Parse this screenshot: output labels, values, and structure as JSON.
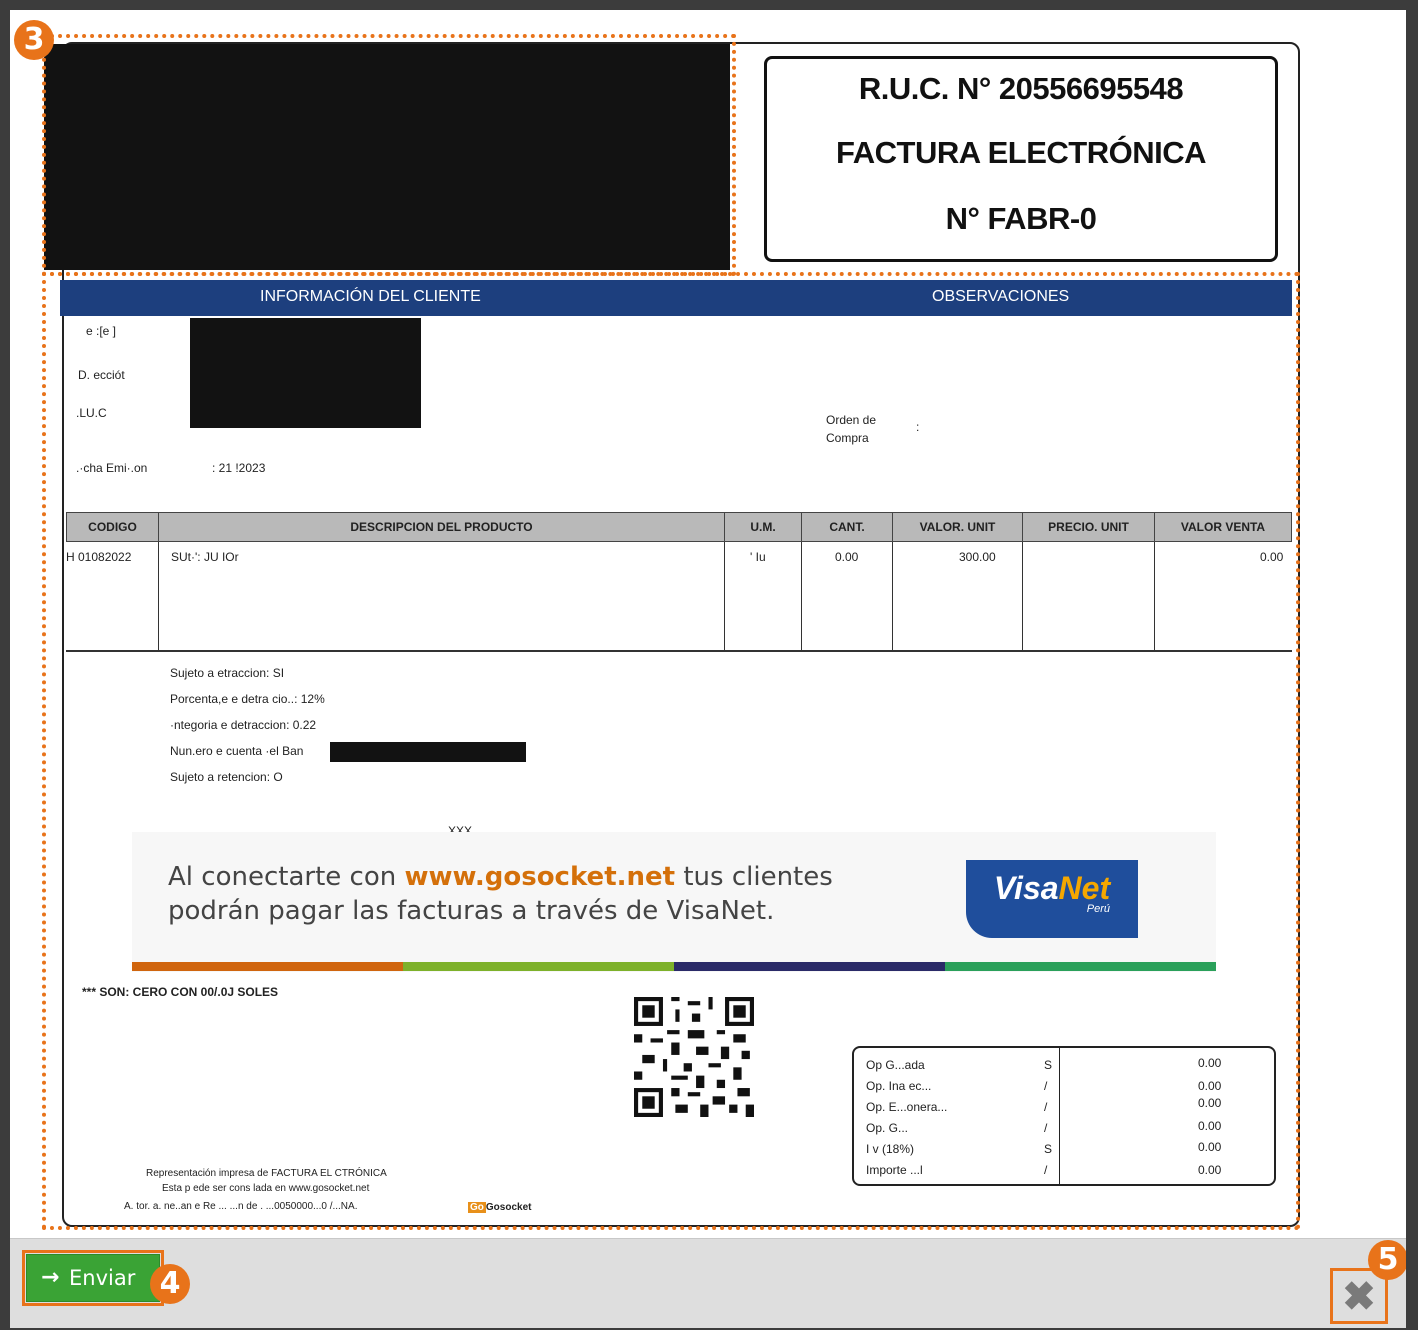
{
  "invoice": {
    "ruc_line": "R.U.C. N° 20556695548",
    "type_line": "FACTURA ELECTRÓNICA",
    "number_line": "N° FABR-0"
  },
  "sections": {
    "client_info": "INFORMACIÓN DEL CLIENTE",
    "observations": "OBSERVACIONES"
  },
  "client": {
    "name_label": "e  :[e ]",
    "address_label": "D. ecciót",
    "ruc_label": ".LU.C",
    "date_label": ".·cha Emi·.on",
    "date_value": ":   21    !2023",
    "order_label_1": "Orden de",
    "order_label_2": "Compra",
    "order_colon": ":"
  },
  "table": {
    "headers": [
      "CODIGO",
      "DESCRIPCION DEL PRODUCTO",
      "U.M.",
      "CANT.",
      "VALOR. UNIT",
      "PRECIO. UNIT",
      "VALOR VENTA"
    ],
    "row": {
      "code": "H 01082022",
      "description": "SUt·': JU  IOr",
      "unit": "' Iu",
      "qty": "0.00",
      "unit_value": "300.00",
      "unit_price": "",
      "sale_value": "0.00"
    }
  },
  "details": [
    "Sujeto a   etraccion: SI",
    "Porcenta,e   e detra  cio..: 12%",
    "  ·ntegoria   e detraccion: 0.22",
    "Nun.ero   e cuenta ·el Ban",
    "Sujeto a retencion:    O"
  ],
  "observation_text": "XXX",
  "banner": {
    "line1_pre": "Al conectarte con ",
    "line1_link": "www.gosocket.net",
    "line1_post": " tus clientes",
    "line2": "podrán pagar las facturas a través de VisaNet.",
    "logo_main": "Visa",
    "logo_accent": "Net",
    "logo_sub": "Perú",
    "stripe_colors": [
      "#d0650e",
      "#7db12a",
      "#2a2a68",
      "#2aa05a"
    ]
  },
  "amount_in_words": "*** SON: CERO CON 00/.0J SOLES",
  "totals": {
    "labels": [
      "Op  G...ada",
      "Op. Ina ec...",
      "Op. E...onera...",
      "Op. G...",
      "I  v (18%)",
      "Importe ...l"
    ],
    "currency": [
      "S",
      "/",
      "/",
      "/",
      "S",
      "/"
    ],
    "values": [
      "0.00",
      "0.00",
      "0.00",
      "0.00",
      "0.00",
      "0.00"
    ]
  },
  "footer_notes": {
    "line1": "Representación impresa de FACTURA EL  CTRÓNICA",
    "line2": "Esta p  ede ser cons  lada en www.gosocket.net",
    "line3": "A. tor. a.   ne..an e Re  ...  ...n de .   ...0050000...0 /...NA.",
    "brand": "Gosocket"
  },
  "markers": {
    "doc": "3",
    "send": "4",
    "close": "5"
  },
  "actions": {
    "send_label": "Enviar",
    "send_icon": "→",
    "close_icon": "✖"
  }
}
